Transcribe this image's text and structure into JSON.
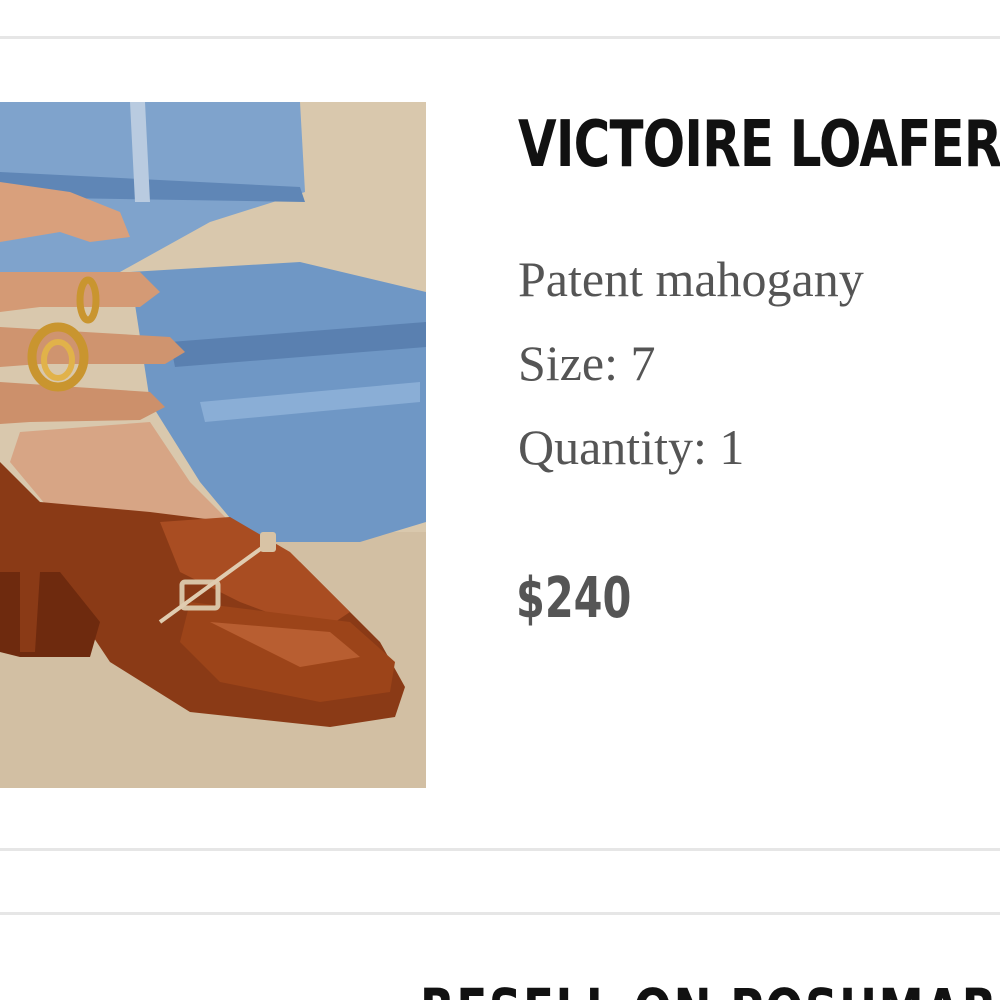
{
  "product": {
    "title": "VICTOIRE LOAFERS",
    "color": "Patent mahogany",
    "size": "Size: 7",
    "quantity": "Quantity: 1",
    "price": "$240",
    "image_icon": "product-photo"
  },
  "actions": {
    "resell_label": "RESELL ON POSHMARK"
  },
  "colors": {
    "title": "#111111",
    "detail_text": "#555555",
    "divider": "#e6e6e6",
    "shoe": "#8a3a16",
    "denim": "#6b93c2"
  }
}
